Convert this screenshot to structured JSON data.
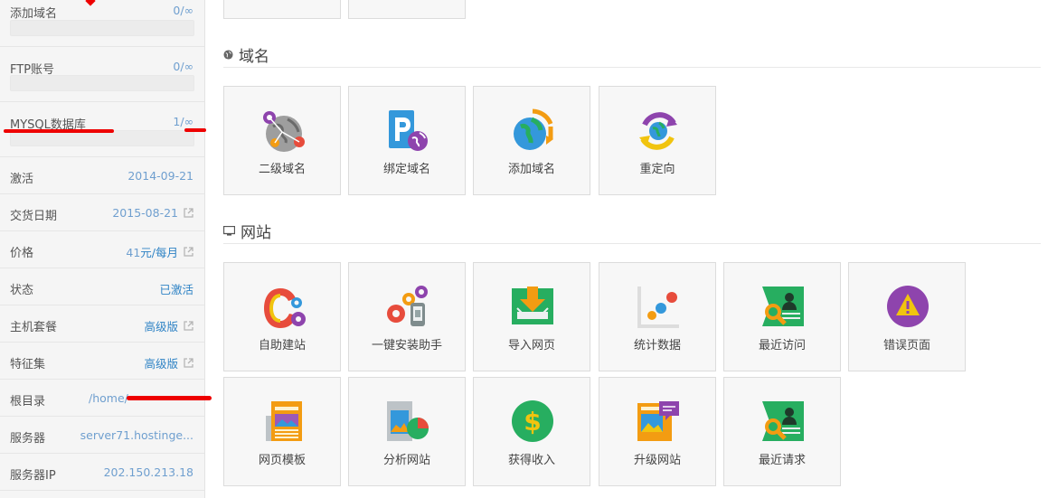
{
  "sidebar": {
    "quota": [
      {
        "label": "添加域名",
        "value": "0/∞"
      },
      {
        "label": "FTP账号",
        "value": "0/∞"
      },
      {
        "label": "MYSQL数据库",
        "value": "1/∞"
      }
    ],
    "rows": [
      {
        "label": "激活",
        "value": "2014-09-21"
      },
      {
        "label": "交货日期",
        "value": "2015-08-21"
      },
      {
        "label": "价格",
        "value_amount": "41",
        "value_unit": "元/每月"
      },
      {
        "label": "状态",
        "value": "已激活"
      },
      {
        "label": "主机套餐",
        "value": "高级版"
      },
      {
        "label": "特征集",
        "value": "高级版"
      },
      {
        "label": "根目录",
        "value": "/home/"
      },
      {
        "label": "服务器",
        "value": "server71.hostinge..."
      },
      {
        "label": "服务器IP",
        "value": "202.150.213.18"
      }
    ]
  },
  "sections": {
    "domain": {
      "title": "域名",
      "tiles": [
        {
          "label": "二级域名",
          "icon": "subdomain-globe-icon"
        },
        {
          "label": "绑定域名",
          "icon": "parked-domain-icon"
        },
        {
          "label": "添加域名",
          "icon": "addon-domain-icon"
        },
        {
          "label": "重定向",
          "icon": "redirect-icon"
        }
      ]
    },
    "website": {
      "title": "网站",
      "tiles": [
        {
          "label": "自助建站",
          "icon": "site-builder-icon"
        },
        {
          "label": "一键安装助手",
          "icon": "auto-installer-icon"
        },
        {
          "label": "导入网页",
          "icon": "import-website-icon"
        },
        {
          "label": "统计数据",
          "icon": "statistics-icon"
        },
        {
          "label": "最近访问",
          "icon": "access-logs-icon"
        },
        {
          "label": "错误页面",
          "icon": "error-pages-icon"
        },
        {
          "label": "网页模板",
          "icon": "website-templates-icon"
        },
        {
          "label": "分析网站",
          "icon": "website-analysis-icon"
        },
        {
          "label": "获得收入",
          "icon": "earn-money-icon"
        },
        {
          "label": "升级网站",
          "icon": "upgrade-website-icon"
        },
        {
          "label": "最近请求",
          "icon": "recent-requests-icon"
        }
      ]
    }
  },
  "colors": {
    "accent": "#2f83c5",
    "redact": "#e00000"
  }
}
